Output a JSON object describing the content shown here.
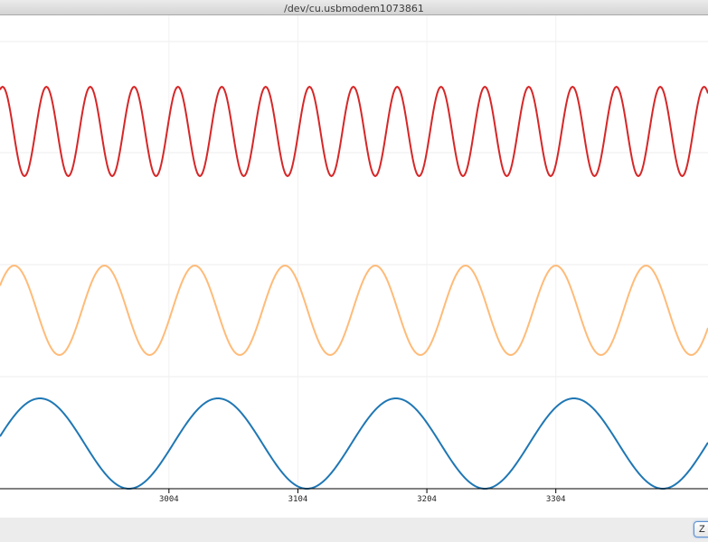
{
  "window": {
    "title": "/dev/cu.usbmodem1073861"
  },
  "footer": {
    "button_label": "Z"
  },
  "chart_data": {
    "type": "line",
    "title": "",
    "xlabel": "",
    "ylabel": "",
    "xlim": [
      2873,
      3422
    ],
    "x_ticks": [
      3004,
      3104,
      3204,
      3304
    ],
    "x_tick_labels": [
      "3004",
      "3104",
      "3204",
      "3304"
    ],
    "grid": true,
    "legend": "none",
    "series": [
      {
        "color": "#d62728",
        "sample_spacing": 1,
        "amplitude": 1.0,
        "period": 34,
        "peaks_at": [
          2875,
          2909,
          2943,
          2977,
          3011,
          3045,
          3079,
          3113,
          3147,
          3181,
          3215,
          3249,
          3283,
          3317,
          3351,
          3385,
          3419
        ]
      },
      {
        "color": "#ffbb78",
        "sample_spacing": 1,
        "amplitude": 1.0,
        "period": 70,
        "peaks_at": [
          2884,
          2954,
          3024,
          3094,
          3164,
          3234,
          3304,
          3374
        ]
      },
      {
        "color": "#1f77b4",
        "sample_spacing": 1,
        "amplitude": 1.0,
        "period": 138,
        "peaks_at": [
          2904,
          3042,
          3180,
          3318
        ]
      }
    ]
  }
}
